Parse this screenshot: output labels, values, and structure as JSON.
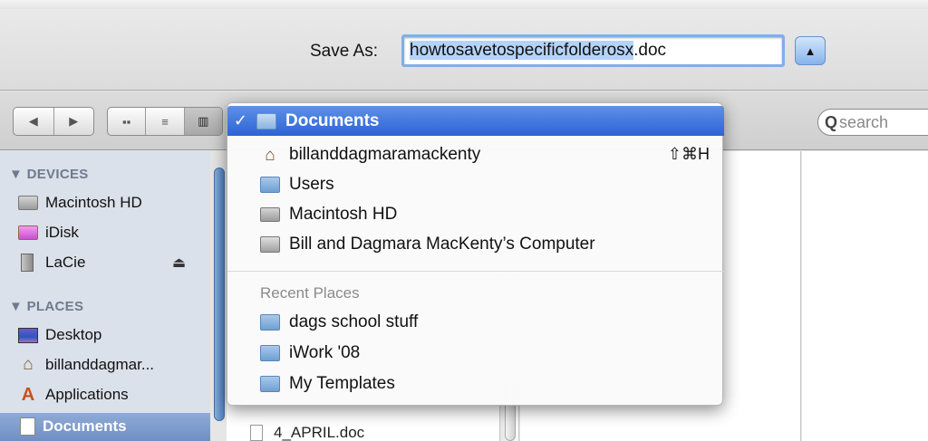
{
  "save_panel": {
    "label": "Save As:",
    "filename_selected": "howtosavetospecificfolderosx",
    "filename_ext": ".doc",
    "collapse_icon": "triangle-up-icon"
  },
  "toolbar": {
    "back_glyph": "◀",
    "forward_glyph": "▶",
    "icon_view_glyph": "▪▪",
    "list_view_glyph": "≡",
    "column_view_glyph": "▥",
    "search_icon": "magnifier-icon",
    "search_placeholder": "search"
  },
  "sidebar": {
    "devices_header": "▼ DEVICES",
    "devices": [
      {
        "label": "Macintosh HD",
        "icon": "hard-drive-icon"
      },
      {
        "label": "iDisk",
        "icon": "idisk-icon"
      },
      {
        "label": "LaCie",
        "icon": "external-drive-icon",
        "eject": "⏏"
      }
    ],
    "places_header": "▼ PLACES",
    "places": [
      {
        "label": "Desktop",
        "icon": "desktop-icon"
      },
      {
        "label": "billanddagmar...",
        "icon": "home-icon"
      },
      {
        "label": "Applications",
        "icon": "applications-icon"
      },
      {
        "label": "Documents",
        "icon": "documents-icon",
        "selected": true
      }
    ]
  },
  "browser": {
    "files": [
      {
        "label": "4_APRIL.doc"
      }
    ]
  },
  "popup_menu": {
    "items": [
      {
        "label": "Documents",
        "checked": "✓",
        "icon": "documents-folder-icon",
        "selected": true
      },
      {
        "label": "billanddagmaramackenty",
        "icon": "home-icon",
        "shortcut": "⇧⌘H"
      },
      {
        "label": "Users",
        "icon": "users-folder-icon"
      },
      {
        "label": "Macintosh HD",
        "icon": "hard-drive-icon"
      },
      {
        "label": "Bill and Dagmara MacKenty’s Computer",
        "icon": "computer-icon"
      }
    ],
    "recent_header": "Recent Places",
    "recent": [
      {
        "label": "dags school stuff",
        "icon": "folder-icon"
      },
      {
        "label": "iWork '08",
        "icon": "folder-icon"
      },
      {
        "label": "My Templates",
        "icon": "folder-icon"
      }
    ]
  }
}
